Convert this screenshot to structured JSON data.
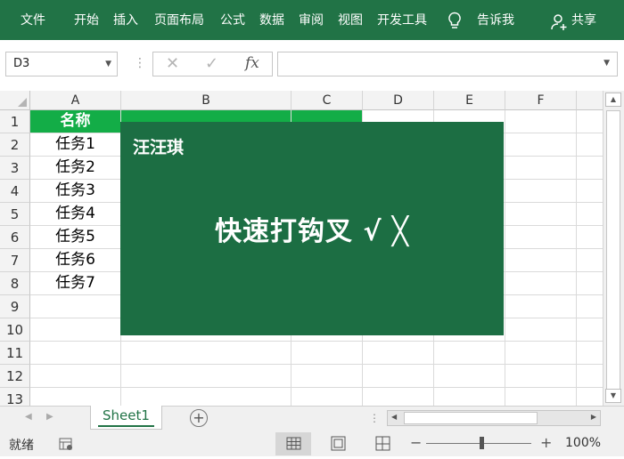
{
  "ribbon": {
    "tabs": [
      "文件",
      "开始",
      "插入",
      "页面布局",
      "公式",
      "数据",
      "审阅",
      "视图",
      "开发工具"
    ],
    "tell_me": "告诉我",
    "share": "共享"
  },
  "formula_bar": {
    "name_box": "D3",
    "cancel_icon": "✕",
    "enter_icon": "✓",
    "fx_label": "fx",
    "formula": ""
  },
  "columns": [
    "A",
    "B",
    "C",
    "D",
    "E",
    "F"
  ],
  "rows": [
    "1",
    "2",
    "3",
    "4",
    "5",
    "6",
    "7",
    "8",
    "9",
    "10",
    "11",
    "12",
    "13"
  ],
  "cells": {
    "A1": "名称",
    "A2": "任务1",
    "A3": "任务2",
    "A4": "任务3",
    "A5": "任务4",
    "A6": "任务5",
    "A7": "任务6",
    "A8": "任务7"
  },
  "overlay": {
    "author": "汪汪琪",
    "headline": "快速打钩叉 √ ╳"
  },
  "sheets": [
    "Sheet1"
  ],
  "status": {
    "mode": "就绪",
    "zoom": "100%"
  },
  "colors": {
    "ribbon": "#217346",
    "header_fill": "#13ad47",
    "overlay_fill": "#1c6e43"
  }
}
